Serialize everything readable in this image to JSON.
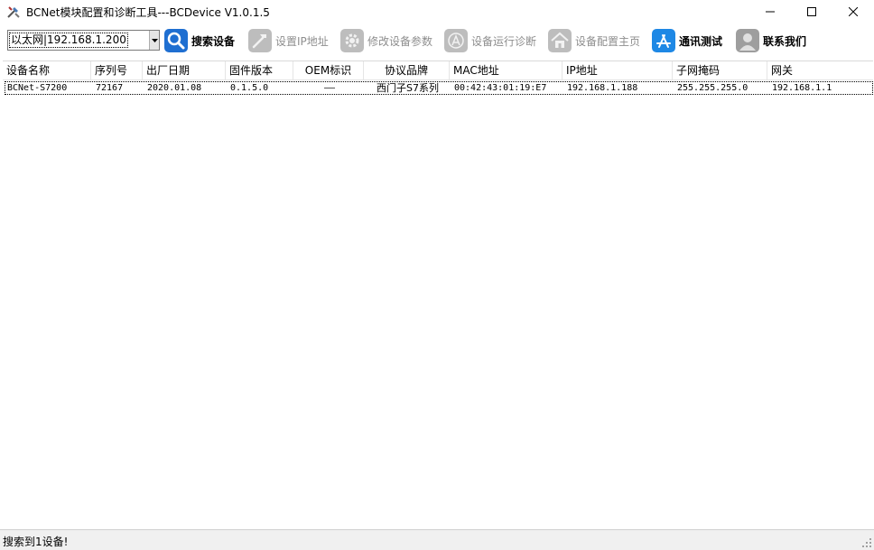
{
  "window": {
    "title": "BCNet模块配置和诊断工具---BCDevice V1.0.1.5",
    "minimize_symbol": "—",
    "maximize_symbol": "☐",
    "close_symbol": "✕"
  },
  "toolbar": {
    "connection_value": "以太网|192.168.1.200",
    "buttons": [
      {
        "label": "搜索设备",
        "icon": "search-icon",
        "enabled": true
      },
      {
        "label": "设置IP地址",
        "icon": "hammer-icon",
        "enabled": false
      },
      {
        "label": "修改设备参数",
        "icon": "gear-icon",
        "enabled": false
      },
      {
        "label": "设备运行诊断",
        "icon": "diagnose-icon",
        "enabled": false
      },
      {
        "label": "设备配置主页",
        "icon": "home-icon",
        "enabled": false
      },
      {
        "label": "通讯测试",
        "icon": "app-store-icon",
        "enabled": true
      },
      {
        "label": "联系我们",
        "icon": "contact-person-icon",
        "enabled": true
      }
    ]
  },
  "table": {
    "columns": [
      "设备名称",
      "序列号",
      "出厂日期",
      "固件版本",
      "OEM标识",
      "协议品牌",
      "MAC地址",
      "IP地址",
      "子网掩码",
      "网关"
    ],
    "rows": [
      [
        "BCNet-S7200",
        "72167",
        "2020.01.08",
        "0.1.5.0",
        "——",
        "西门子S7系列",
        "00:42:43:01:19:E7",
        "192.168.1.188",
        "255.255.255.0",
        "192.168.1.1"
      ]
    ]
  },
  "status": {
    "text": "搜索到1设备!"
  },
  "colors": {
    "search_blue": "#1f6fd1",
    "app_store_blue": "#1e88e5",
    "disabled_gray": "#8e8e8e"
  }
}
